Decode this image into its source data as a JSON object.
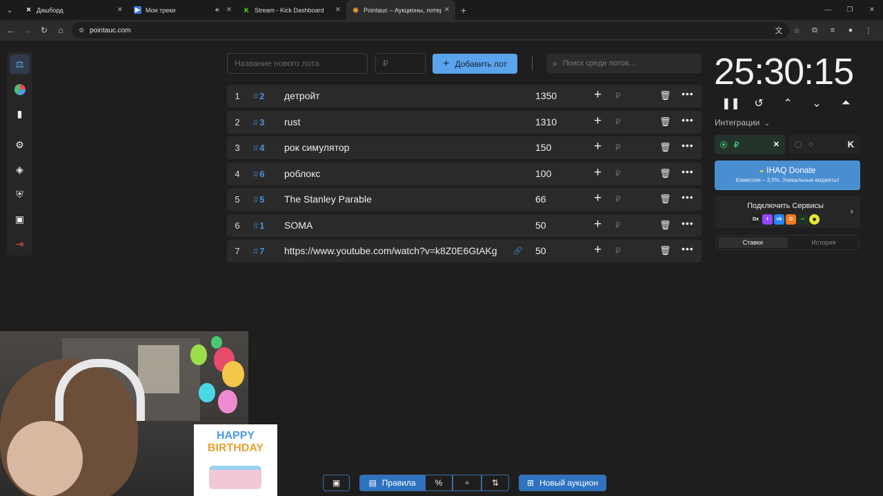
{
  "browser": {
    "tabs": [
      {
        "label": "Дашборд",
        "icon": "x-logo-icon"
      },
      {
        "label": "Мои треки",
        "icon": "play-icon"
      },
      {
        "label": "Stream - Kick Dashboard",
        "icon": "kick-icon"
      },
      {
        "label": "Pointauc – Аукционы, лотереи",
        "icon": "pointauc-icon"
      }
    ],
    "url": "pointauc.com"
  },
  "form": {
    "name_placeholder": "Название нового лота",
    "amount_placeholder": "₽",
    "add_label": "Добавить лот",
    "search_placeholder": "Поиск среди лотов..."
  },
  "lots": [
    {
      "num": "1",
      "fast": "2",
      "name": "детройт",
      "amount": "1350",
      "link": false
    },
    {
      "num": "2",
      "fast": "3",
      "name": "rust",
      "amount": "1310",
      "link": false
    },
    {
      "num": "3",
      "fast": "4",
      "name": "рок симулятор",
      "amount": "150",
      "link": false
    },
    {
      "num": "4",
      "fast": "6",
      "name": "роблокс",
      "amount": "100",
      "link": false
    },
    {
      "num": "5",
      "fast": "5",
      "name": "The Stanley Parable",
      "amount": "66",
      "link": false
    },
    {
      "num": "6",
      "fast": "1",
      "name": "SOMA",
      "amount": "50",
      "link": false
    },
    {
      "num": "7",
      "fast": "7",
      "name": "https://www.youtube.com/watch?v=k8Z0E6GtAKg",
      "amount": "50",
      "link": true
    }
  ],
  "lot_currency": "₽",
  "timer": "25:30:15",
  "integrations": {
    "label": "Интеграции",
    "currency": "₽"
  },
  "ihaq": {
    "title": "IHAQ Donate",
    "subtitle": "Комиссия – 3,5%. Уникальные виджеты!"
  },
  "services": {
    "label": "Подключить Сервисы",
    "icons": [
      "donatex-icon",
      "twitch-icon",
      "vk-icon",
      "donationalerts-icon",
      "chain-icon",
      "kick-green-icon"
    ]
  },
  "history_tabs": {
    "bids": "Ставки",
    "history": "История"
  },
  "bottom": {
    "rules": "Правила",
    "new_auction": "Новый аукцион"
  },
  "birthday": {
    "text1": "HAPPY",
    "text2": "BIRTHDAY"
  },
  "colors": {
    "accent": "#5ba3ea",
    "fast_id": "#4a90d9",
    "logout": "#e04848",
    "integration_on": "#40c070"
  }
}
